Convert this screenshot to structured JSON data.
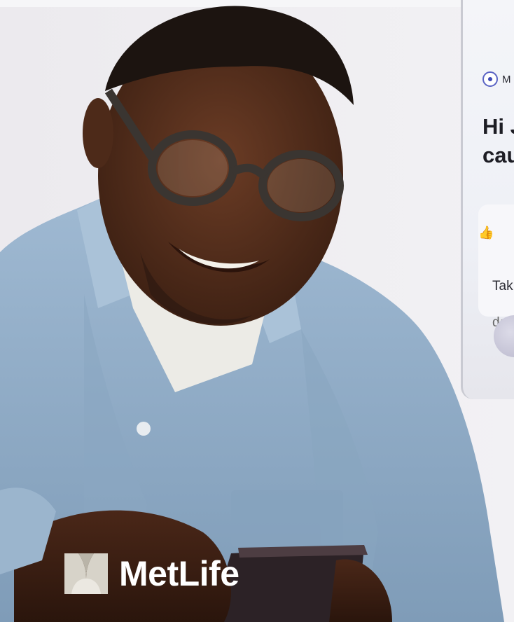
{
  "brand": {
    "name": "MetLife"
  },
  "phone": {
    "brand_initial": "M",
    "greeting": "Hi J\ncau",
    "tip_line1": "Tak",
    "tip_line2": "dat"
  },
  "icons": [
    "radio-dot-icon",
    "thumbs-up-icon"
  ]
}
